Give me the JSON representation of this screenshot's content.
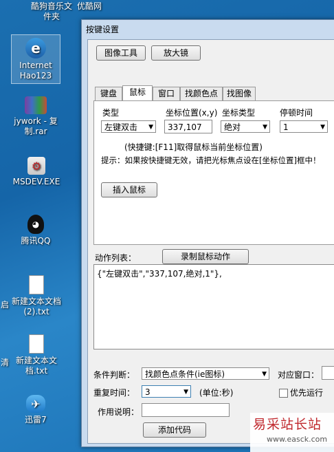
{
  "desktop": {
    "top_left": "",
    "music": "酷狗音乐文件夹",
    "youku": "优酷网",
    "ie": "Internet Hao123",
    "jywork": "jywork - 复制.rar",
    "msdev": "MSDEV.EXE",
    "qq": "腾讯QQ",
    "txt1": "新建文本文档 (2).txt",
    "txt2": "新建文本文档.txt",
    "xunlei": "迅雷7",
    "edge_start": "启",
    "edge_qing": "清"
  },
  "window": {
    "title": "按键设置",
    "image_tool_button": "图像工具",
    "zoom_button": "放大镜",
    "tabs": [
      "键盘",
      "鼠标",
      "窗口",
      "找颜色点",
      "找图像"
    ],
    "type_label": "类型",
    "type_value": "左键双击",
    "coord_label": "坐标位置(x,y)",
    "coord_value": "337,107",
    "coord_type_label": "坐标类型",
    "coord_type_value": "绝对",
    "pause_label": "停顿时间",
    "pause_value": "1",
    "hint_shortcut": "(快捷键:[F11]取得鼠标当前坐标位置)",
    "hint_tip": "提示：如果按快捷键无效，请把光标焦点设在[坐标位置]框中！",
    "insert_mouse_button": "插入鼠标",
    "action_list_label": "动作列表：",
    "record_button": "录制鼠标动作",
    "action_list_text": "{\"左键双击\",\"337,107,绝对,1\"},",
    "condition_label": "条件判断：",
    "condition_value": "找颜色点条件(ie图标)",
    "target_window_label": "对应窗口：",
    "repeat_label": "重复时间：",
    "repeat_value": "3",
    "repeat_unit": "(单位:秒)",
    "priority_label": "优先运行",
    "desc_label": "作用说明：",
    "desc_value": "",
    "add_code_button": "添加代码"
  },
  "watermark": {
    "text": "易采站长站",
    "url": "www.easck.com"
  }
}
